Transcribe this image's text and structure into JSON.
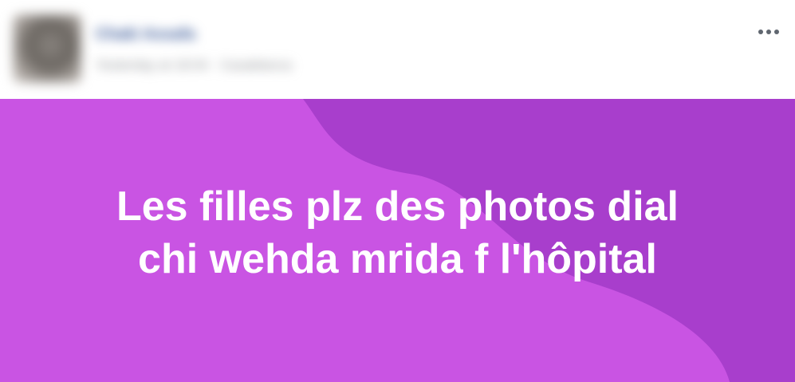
{
  "post": {
    "author": {
      "name": "Chaki Assafa",
      "meta": "Yesterday at 18:04 · Casablanca"
    },
    "more_icon": "more-horizontal-icon",
    "message_lines": [
      "Les filles plz des photos dial",
      "chi wehda mrida f l'hôpital"
    ],
    "background": {
      "base_color": "#c954e3",
      "wave_color": "#a83ecc",
      "text_color": "#ffffff"
    }
  }
}
